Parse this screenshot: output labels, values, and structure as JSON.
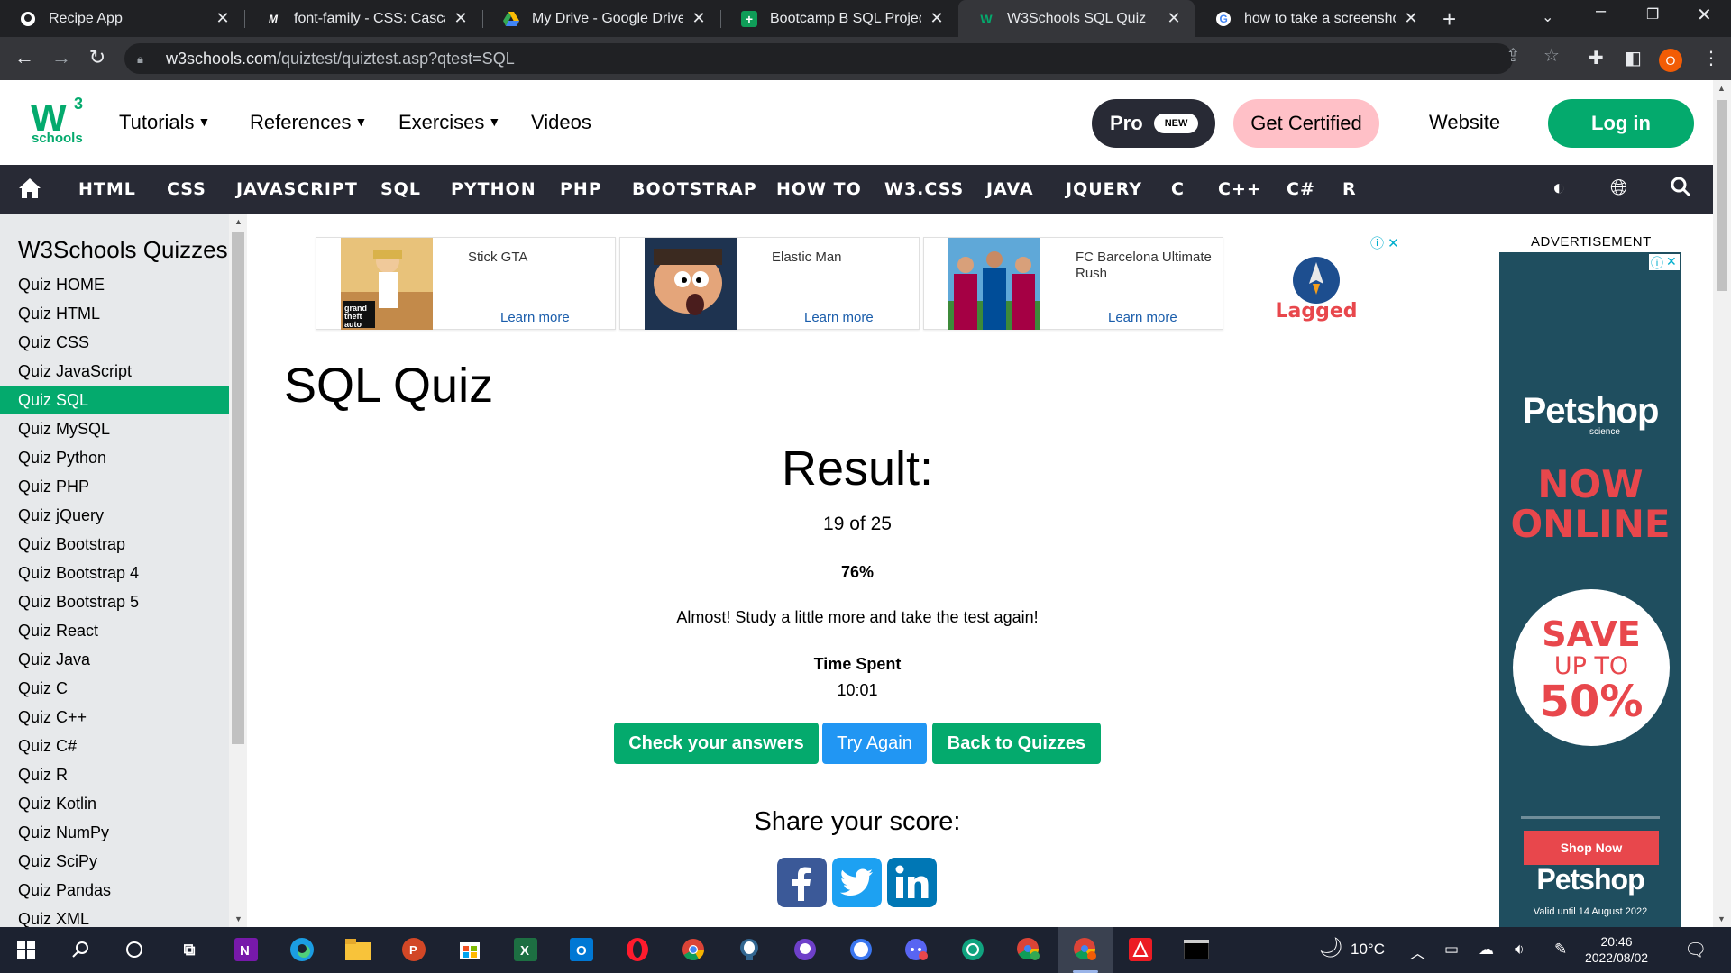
{
  "browser": {
    "tabs": [
      {
        "title": "Recipe App",
        "icon": "github-icon"
      },
      {
        "title": "font-family - CSS: Cascading",
        "icon": "mdn-icon"
      },
      {
        "title": "My Drive - Google Drive",
        "icon": "google-drive-icon"
      },
      {
        "title": "Bootcamp B SQL Projects -",
        "icon": "google-sheets-icon"
      },
      {
        "title": "W3Schools SQL Quiz",
        "icon": "w3schools-icon"
      },
      {
        "title": "how to take a screenshot o",
        "icon": "google-icon"
      }
    ],
    "active_tab_index": 4,
    "url_host": "w3schools.com",
    "url_path": "/quiztest/quiztest.asp?qtest=SQL",
    "profile_initial": "O"
  },
  "topnav": {
    "logo_sup": "3",
    "logo_text": "schools",
    "menu": [
      "Tutorials",
      "References",
      "Exercises",
      "Videos"
    ],
    "pro": "Pro",
    "pro_badge": "NEW",
    "certified": "Get Certified",
    "website": "Website",
    "login": "Log in"
  },
  "darknav": [
    "HTML",
    "CSS",
    "JAVASCRIPT",
    "SQL",
    "PYTHON",
    "PHP",
    "BOOTSTRAP",
    "HOW TO",
    "W3.CSS",
    "JAVA",
    "JQUERY",
    "C",
    "C++",
    "C#",
    "R"
  ],
  "sidebar": {
    "heading": "W3Schools Quizzes",
    "active": "Quiz SQL",
    "items": [
      "Quiz HOME",
      "Quiz HTML",
      "Quiz CSS",
      "Quiz JavaScript",
      "Quiz SQL",
      "Quiz MySQL",
      "Quiz Python",
      "Quiz PHP",
      "Quiz jQuery",
      "Quiz Bootstrap",
      "Quiz Bootstrap 4",
      "Quiz Bootstrap 5",
      "Quiz React",
      "Quiz Java",
      "Quiz C",
      "Quiz C++",
      "Quiz C#",
      "Quiz R",
      "Quiz Kotlin",
      "Quiz NumPy",
      "Quiz SciPy",
      "Quiz Pandas",
      "Quiz XML"
    ]
  },
  "ads": [
    {
      "title": "Stick GTA",
      "cta": "Learn more",
      "thumb_label": "grand theft auto"
    },
    {
      "title": "Elastic Man",
      "cta": "Learn more"
    },
    {
      "title": "FC Barcelona Ultimate Rush",
      "cta": "Learn more"
    }
  ],
  "ads_brand": "Lagged",
  "quiz": {
    "title": "SQL Quiz",
    "result_heading": "Result:",
    "score": "19 of 25",
    "percent": "76%",
    "message": "Almost! Study a little more and take the test again!",
    "time_label": "Time Spent",
    "time_value": "10:01",
    "buttons": {
      "check": "Check your answers",
      "retry": "Try Again",
      "back": "Back to Quizzes"
    },
    "share_heading": "Share your score:"
  },
  "right_ad": {
    "label": "ADVERTISEMENT",
    "brand": "Petshop",
    "brand_sub": "science",
    "headline_1": "NOW",
    "headline_2": "ONLINE",
    "save_1": "SAVE",
    "save_2": "UP TO",
    "save_3": "50%",
    "cta": "Shop Now",
    "valid": "Valid until 14 August 2022"
  },
  "taskbar": {
    "weather": "10°C",
    "time": "20:46",
    "date": "2022/08/02"
  },
  "colors": {
    "brand_green": "#04aa6d",
    "dark_nav": "#282a35",
    "sidebar_bg": "#e7e9eb",
    "blue_button": "#2196f3"
  }
}
